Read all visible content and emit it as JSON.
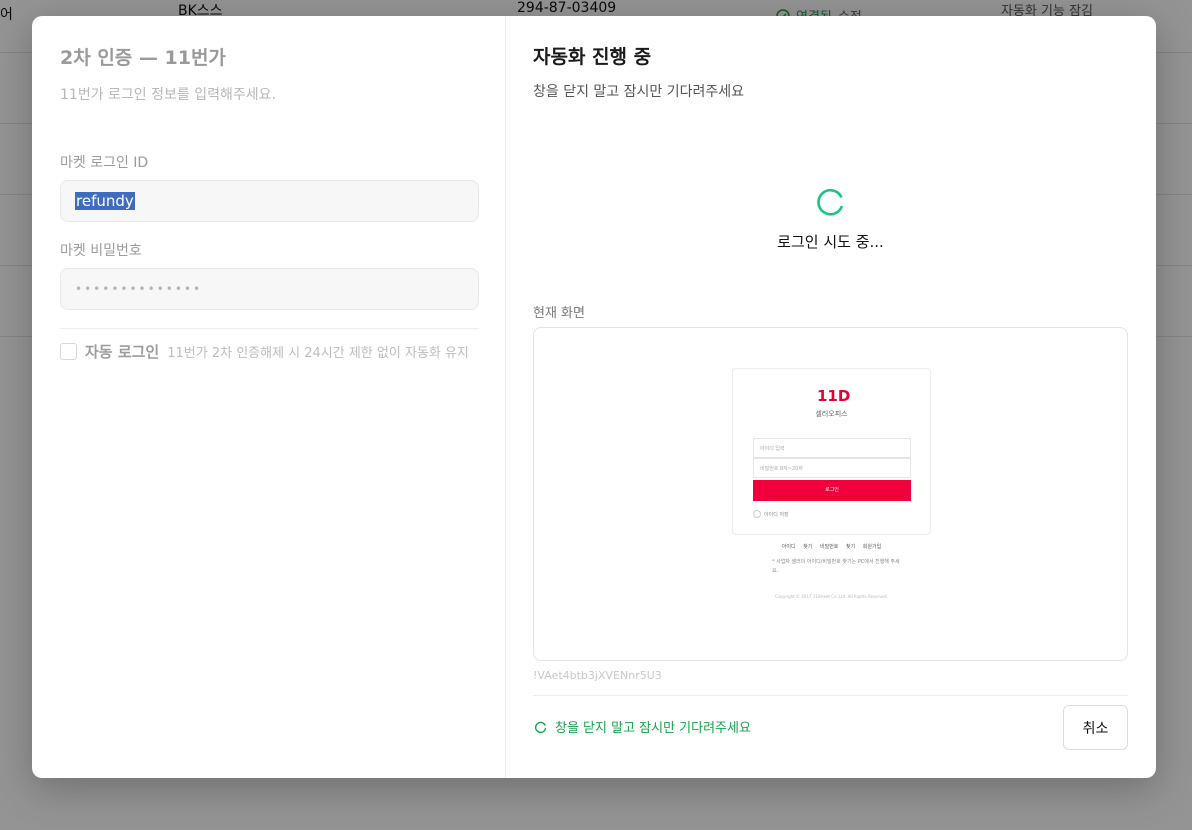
{
  "background": {
    "row1": {
      "partial_label": "어",
      "seller": "BK스스",
      "biz_no": "294-87-03409",
      "status": "연결됨",
      "edit": "수정",
      "feature": "자동화 기능 잠김"
    }
  },
  "modal": {
    "left": {
      "title": "2차 인증 — 11번가",
      "subtitle": "11번가 로그인 정보를 입력해주세요.",
      "id_label": "마켓 로그인 ID",
      "id_value": "refundy",
      "pw_label": "마켓 비밀번호",
      "pw_value": "••••••••••••••",
      "auto_login_label": "자동 로그인",
      "auto_login_hint": "11번가 2차 인증해제 시 24시간 제한 없이 자동화 유지"
    },
    "right": {
      "title": "자동화 진행 중",
      "subtitle": "창을 닫지 말고 잠시만 기다려주세요",
      "spinner_text": "로그인 시도 중...",
      "screen_label": "현재 화면",
      "session_id": "!VAet4btb3jXVENnr5U3",
      "footer_status": "창을 닫지 말고 잠시만 기다려주세요",
      "cancel_label": "취소",
      "accent_color": "#16c784"
    },
    "preview": {
      "logo": "11D",
      "brand": "셀러오피스",
      "id_placeholder": "아이디 입력",
      "pw_placeholder": "비밀번호 8자~20자",
      "login_btn": "로그인",
      "remember": "아이디 저장",
      "links": "아이디 찾기 비밀번호 찾기 회원가입",
      "note": "* 사업자 셀러의 아이디/비밀번호 찾기는 PC에서 진행해 주세요.",
      "copyright": "Copyright © 2017 11Street Co.,Ltd. All Rights Reserved."
    }
  }
}
